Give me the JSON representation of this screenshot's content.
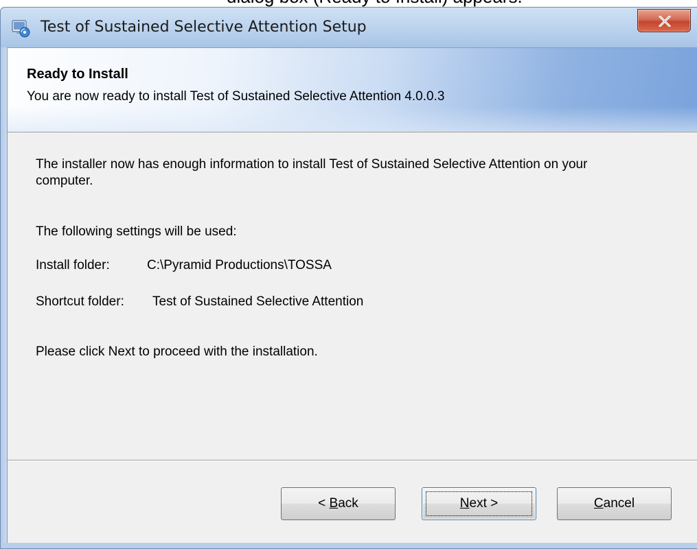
{
  "top_strip": {
    "text": "dialog box (Ready to Install) appears."
  },
  "window": {
    "title": "Test of Sustained Selective Attention Setup",
    "icon": "installer-icon",
    "close_icon": "close-icon",
    "accent_color": "#c4452e"
  },
  "banner": {
    "title": "Ready to Install",
    "subtitle": "You are now ready to install Test of Sustained Selective Attention 4.0.0.3"
  },
  "body": {
    "intro_line1": "The installer now has enough information to install Test of Sustained Selective Attention on your",
    "intro_line2": "computer.",
    "settings_heading": "The following settings will be used:",
    "install_folder_label": "Install folder:",
    "install_folder_value": "C:\\Pyramid Productions\\TOSSA",
    "shortcut_folder_label": "Shortcut folder:",
    "shortcut_folder_value": "Test of Sustained Selective Attention",
    "proceed_text": "Please click Next to proceed with the installation."
  },
  "buttons": {
    "back": {
      "prefix": "< ",
      "mnemonic": "B",
      "rest": "ack"
    },
    "next": {
      "mnemonic": "N",
      "rest": "ext >"
    },
    "cancel": {
      "mnemonic": "C",
      "rest": "ancel"
    }
  }
}
